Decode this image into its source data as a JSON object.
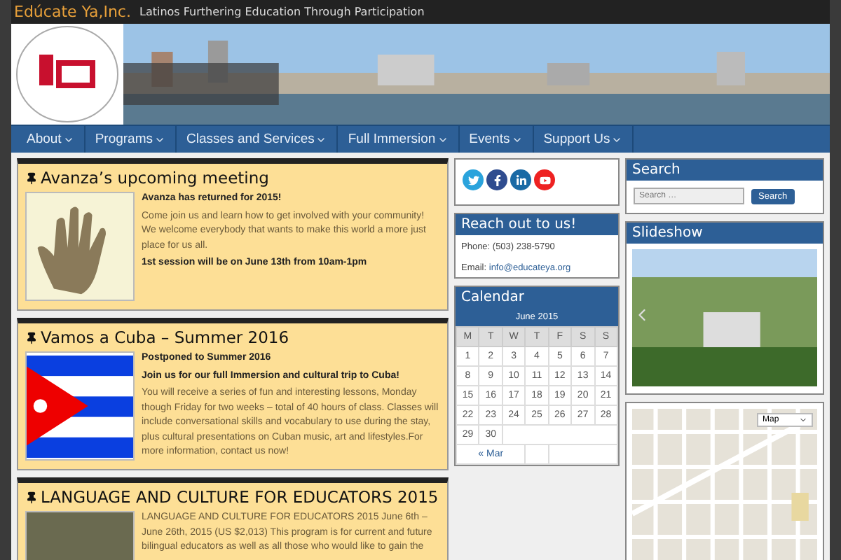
{
  "site": {
    "title": "Edúcate Ya,Inc.",
    "tagline": "Latinos Furthering Education Through Participation"
  },
  "nav": [
    {
      "label": "About"
    },
    {
      "label": "Programs"
    },
    {
      "label": "Classes and Services"
    },
    {
      "label": "Full Immersion"
    },
    {
      "label": "Events"
    },
    {
      "label": "Support Us"
    }
  ],
  "posts": [
    {
      "title": "Avanza’s upcoming meeting",
      "kind": "hand",
      "paragraphs": [
        {
          "kind": "bold",
          "text": "Avanza has returned for 2015!"
        },
        {
          "kind": "plain",
          "text": "Come join us and learn how to get involved with your community! We welcome everybody that wants to make this world a more just place for us all."
        },
        {
          "kind": "bold",
          "text": "1st session will be on June 13th from 10am-1pm"
        }
      ]
    },
    {
      "title": "Vamos a Cuba – Summer 2016",
      "kind": "flag",
      "paragraphs": [
        {
          "kind": "bold",
          "text": "Postponed to Summer 2016"
        },
        {
          "kind": "bold",
          "text": "Join us for our full Immersion and cultural trip to Cuba!"
        },
        {
          "kind": "plain",
          "text": "You will receive a series of fun and interesting lessons, Monday though Friday for two weeks – total of 40 hours of class. Classes will include conversational skills and vocabulary to use during the stay, plus cultural presentations on Cuban music, art and lifestyles.For more information, contact us now!"
        }
      ]
    },
    {
      "title": "LANGUAGE AND CULTURE FOR EDUCATORS 2015",
      "kind": "photo",
      "paragraphs": [
        {
          "kind": "plain",
          "text": "LANGUAGE AND CULTURE FOR EDUCATORS 2015 June 6th – June 26th, 2015 (US $2,013) This program is for current and future bilingual educators as well as all those who would like to gain the"
        }
      ]
    }
  ],
  "social": [
    {
      "kind": "twitter"
    },
    {
      "kind": "facebook"
    },
    {
      "kind": "linkedin"
    },
    {
      "kind": "youtube"
    }
  ],
  "contact": {
    "title": "Reach out to us!",
    "phone": "Phone: (503) 238-5790",
    "email_label": "Email:",
    "email": "info@educateya.org"
  },
  "calendar": {
    "title": "Calendar",
    "month": "June 2015",
    "weekdays": [
      "M",
      "T",
      "W",
      "T",
      "F",
      "S",
      "S"
    ],
    "weeks": [
      [
        "1",
        "2",
        "3",
        "4",
        "5",
        "6",
        "7"
      ],
      [
        "8",
        "9",
        "10",
        "11",
        "12",
        "13",
        "14"
      ],
      [
        "15",
        "16",
        "17",
        "18",
        "19",
        "20",
        "21"
      ],
      [
        "22",
        "23",
        "24",
        "25",
        "26",
        "27",
        "28"
      ],
      [
        "29",
        "30"
      ]
    ],
    "prev_link": "« Mar"
  },
  "search": {
    "title": "Search",
    "placeholder": "Search …",
    "button": "Search"
  },
  "slideshow": {
    "title": "Slideshow"
  },
  "map": {
    "type_control": "Map"
  }
}
